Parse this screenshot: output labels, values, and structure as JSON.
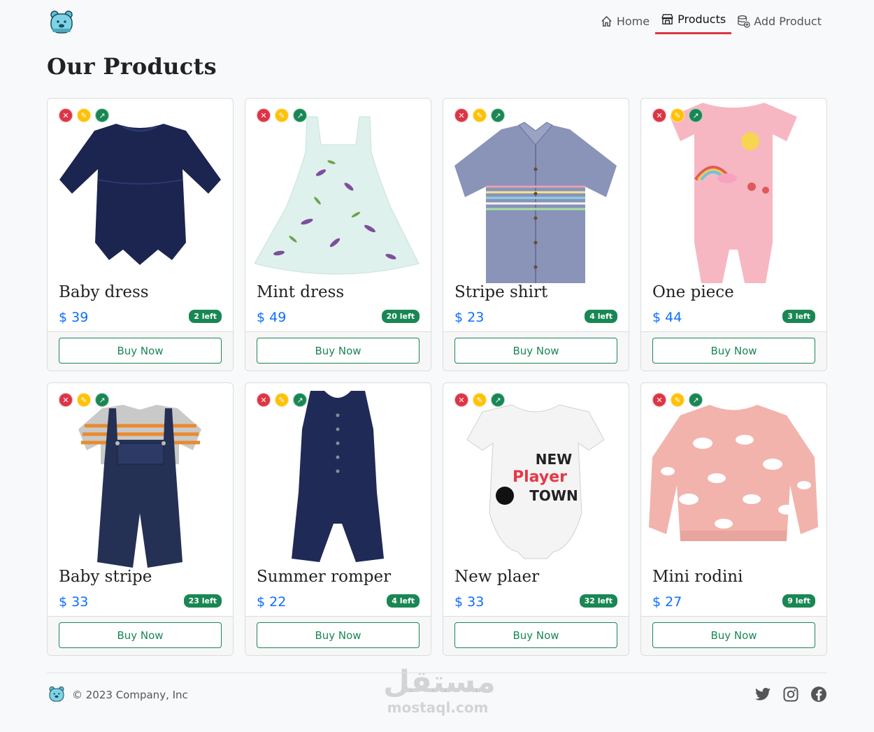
{
  "nav": {
    "home": "Home",
    "products": "Products",
    "add_product": "Add Product"
  },
  "page_title": "Our Products",
  "accent_colors": {
    "primary": "#0d6efd",
    "success": "#198754",
    "danger": "#dc3545",
    "warning": "#ffc107"
  },
  "products": [
    {
      "name": "Baby dress",
      "price": "$ 39",
      "stock": "2 left",
      "button": "Buy Now",
      "image": "navy-baby-dress"
    },
    {
      "name": "Mint dress",
      "price": "$ 49",
      "stock": "20 left",
      "button": "Buy Now",
      "image": "mint-floral-dress"
    },
    {
      "name": "Stripe shirt",
      "price": "$ 23",
      "stock": "4 left",
      "button": "Buy Now",
      "image": "chambray-stripe-shirt"
    },
    {
      "name": "One piece",
      "price": "$ 44",
      "stock": "3 left",
      "button": "Buy Now",
      "image": "pink-romper"
    },
    {
      "name": "Baby stripe",
      "price": "$ 33",
      "stock": "23 left",
      "button": "Buy Now",
      "image": "overalls-striped-tee"
    },
    {
      "name": "Summer romper",
      "price": "$ 22",
      "stock": "4 left",
      "button": "Buy Now",
      "image": "navy-sleeveless-romper"
    },
    {
      "name": "New plaer",
      "price": "$ 33",
      "stock": "32 left",
      "button": "Buy Now",
      "image": "white-onesie-new-player"
    },
    {
      "name": "Mini rodini",
      "price": "$ 27",
      "stock": "9 left",
      "button": "Buy Now",
      "image": "pink-cloud-sweater"
    }
  ],
  "footer": {
    "copyright": "© 2023 Company, Inc",
    "social": [
      "twitter-icon",
      "instagram-icon",
      "facebook-icon"
    ]
  },
  "watermark": {
    "arabic": "مستقل",
    "latin": "mostaql.com"
  }
}
